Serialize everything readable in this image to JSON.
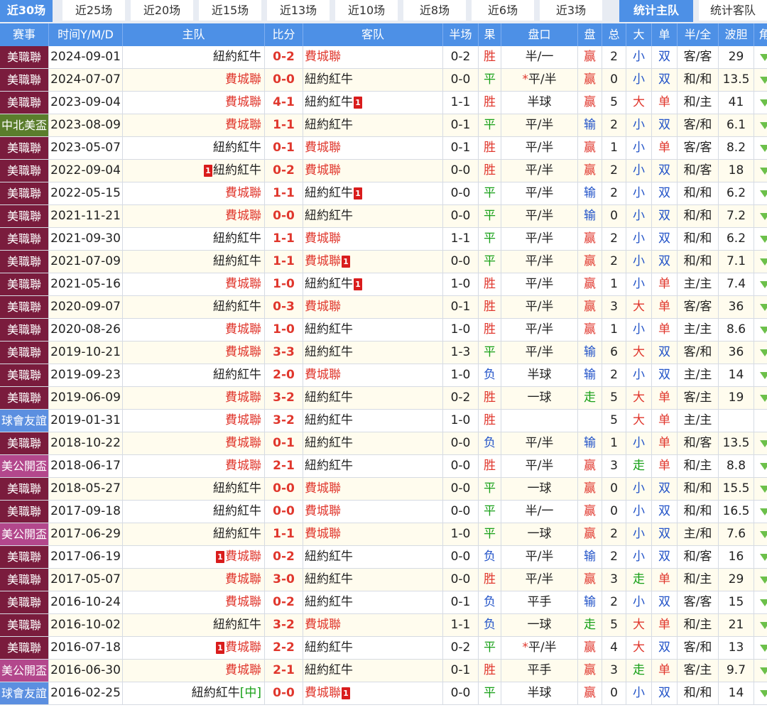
{
  "tabs": [
    "近30场",
    "近25场",
    "近20场",
    "近15场",
    "近13场",
    "近10场",
    "近8场",
    "近6场",
    "近3场",
    "统计主队",
    "统计客队"
  ],
  "headers": [
    "赛事",
    "时间Y/M/D",
    "主队",
    "比分",
    "客队",
    "半场",
    "果",
    "盘口",
    "盘",
    "总",
    "大",
    "单",
    "半/全",
    "波胆",
    "角"
  ],
  "colors": {
    "header_bg": "#4d90e6",
    "mls": "#7a1c3d",
    "concacaf": "#5a7d2c",
    "friendly": "#5b8fe0",
    "us_open": "#b3478c"
  },
  "rows": [
    {
      "league": "美職聯",
      "lt": "mls",
      "date": "2024-09-01",
      "home": "紐約紅牛",
      "home_t": "ny",
      "score": "0-2",
      "away": "費城聯",
      "away_t": "philly",
      "ht": "0-2",
      "res": "胜",
      "rc": "r-win",
      "ah": "半/一",
      "ahr": "赢",
      "ahc": "ah-win",
      "tot": "2",
      "ou": "小",
      "ouc": "small",
      "oe": "双",
      "oec": "even-t",
      "htft": "客/客",
      "odds": "29"
    },
    {
      "league": "美職聯",
      "lt": "mls",
      "date": "2024-07-07",
      "home": "費城聯",
      "home_t": "philly",
      "score": "0-0",
      "away": "紐約紅牛",
      "away_t": "ny",
      "ht": "0-0",
      "res": "平",
      "rc": "r-draw",
      "ah_star": "*",
      "ah": "平/半",
      "ahr": "赢",
      "ahc": "ah-win",
      "tot": "0",
      "ou": "小",
      "ouc": "small",
      "oe": "双",
      "oec": "even-t",
      "htft": "和/和",
      "odds": "13.5"
    },
    {
      "league": "美職聯",
      "lt": "mls",
      "date": "2023-09-04",
      "home": "費城聯",
      "home_t": "philly",
      "score": "4-1",
      "away": "紐約紅牛",
      "away_t": "ny",
      "away_card": "1",
      "ht": "1-1",
      "res": "胜",
      "rc": "r-win",
      "ah": "半球",
      "ahr": "赢",
      "ahc": "ah-win",
      "tot": "5",
      "ou": "大",
      "ouc": "big",
      "oe": "单",
      "oec": "odd-t",
      "htft": "和/主",
      "odds": "41"
    },
    {
      "league": "中北美盃",
      "lt": "concacaf",
      "date": "2023-08-09",
      "home": "費城聯",
      "home_t": "philly",
      "score": "1-1",
      "away": "紐約紅牛",
      "away_t": "ny",
      "ht": "0-1",
      "res": "平",
      "rc": "r-draw",
      "ah": "平/半",
      "ahr": "输",
      "ahc": "ah-lose",
      "tot": "2",
      "ou": "小",
      "ouc": "small",
      "oe": "双",
      "oec": "even-t",
      "htft": "客/和",
      "odds": "6.1"
    },
    {
      "league": "美職聯",
      "lt": "mls",
      "date": "2023-05-07",
      "home": "紐約紅牛",
      "home_t": "ny",
      "score": "0-1",
      "away": "費城聯",
      "away_t": "philly",
      "ht": "0-1",
      "res": "胜",
      "rc": "r-win",
      "ah": "平/半",
      "ahr": "赢",
      "ahc": "ah-win",
      "tot": "1",
      "ou": "小",
      "ouc": "small",
      "oe": "单",
      "oec": "odd-t",
      "htft": "客/客",
      "odds": "8.2"
    },
    {
      "league": "美職聯",
      "lt": "mls",
      "date": "2022-09-04",
      "home_card": "1",
      "home": "紐約紅牛",
      "home_t": "ny",
      "score": "0-2",
      "away": "費城聯",
      "away_t": "philly",
      "ht": "0-0",
      "res": "胜",
      "rc": "r-win",
      "ah": "平/半",
      "ahr": "赢",
      "ahc": "ah-win",
      "tot": "2",
      "ou": "小",
      "ouc": "small",
      "oe": "双",
      "oec": "even-t",
      "htft": "和/客",
      "odds": "18"
    },
    {
      "league": "美職聯",
      "lt": "mls",
      "date": "2022-05-15",
      "home": "費城聯",
      "home_t": "philly",
      "score": "1-1",
      "away": "紐約紅牛",
      "away_t": "ny",
      "away_card": "1",
      "ht": "0-0",
      "res": "平",
      "rc": "r-draw",
      "ah": "平/半",
      "ahr": "输",
      "ahc": "ah-lose",
      "tot": "2",
      "ou": "小",
      "ouc": "small",
      "oe": "双",
      "oec": "even-t",
      "htft": "和/和",
      "odds": "6.2"
    },
    {
      "league": "美職聯",
      "lt": "mls",
      "date": "2021-11-21",
      "home": "費城聯",
      "home_t": "philly",
      "score": "0-0",
      "away": "紐約紅牛",
      "away_t": "ny",
      "ht": "0-0",
      "res": "平",
      "rc": "r-draw",
      "ah": "平/半",
      "ahr": "输",
      "ahc": "ah-lose",
      "tot": "0",
      "ou": "小",
      "ouc": "small",
      "oe": "双",
      "oec": "even-t",
      "htft": "和/和",
      "odds": "7.2"
    },
    {
      "league": "美職聯",
      "lt": "mls",
      "date": "2021-09-30",
      "home": "紐約紅牛",
      "home_t": "ny",
      "score": "1-1",
      "away": "費城聯",
      "away_t": "philly",
      "ht": "1-1",
      "res": "平",
      "rc": "r-draw",
      "ah": "平/半",
      "ahr": "赢",
      "ahc": "ah-win",
      "tot": "2",
      "ou": "小",
      "ouc": "small",
      "oe": "双",
      "oec": "even-t",
      "htft": "和/和",
      "odds": "6.2"
    },
    {
      "league": "美職聯",
      "lt": "mls",
      "date": "2021-07-09",
      "home": "紐約紅牛",
      "home_t": "ny",
      "score": "1-1",
      "away": "費城聯",
      "away_t": "philly",
      "away_card": "1",
      "ht": "0-0",
      "res": "平",
      "rc": "r-draw",
      "ah": "平/半",
      "ahr": "赢",
      "ahc": "ah-win",
      "tot": "2",
      "ou": "小",
      "ouc": "small",
      "oe": "双",
      "oec": "even-t",
      "htft": "和/和",
      "odds": "7.1"
    },
    {
      "league": "美職聯",
      "lt": "mls",
      "date": "2021-05-16",
      "home": "費城聯",
      "home_t": "philly",
      "score": "1-0",
      "away": "紐約紅牛",
      "away_t": "ny",
      "away_card": "1",
      "ht": "1-0",
      "res": "胜",
      "rc": "r-win",
      "ah": "平/半",
      "ahr": "赢",
      "ahc": "ah-win",
      "tot": "1",
      "ou": "小",
      "ouc": "small",
      "oe": "单",
      "oec": "odd-t",
      "htft": "主/主",
      "odds": "7.4"
    },
    {
      "league": "美職聯",
      "lt": "mls",
      "date": "2020-09-07",
      "home": "紐約紅牛",
      "home_t": "ny",
      "score": "0-3",
      "away": "費城聯",
      "away_t": "philly",
      "ht": "0-1",
      "res": "胜",
      "rc": "r-win",
      "ah": "平/半",
      "ahr": "赢",
      "ahc": "ah-win",
      "tot": "3",
      "ou": "大",
      "ouc": "big",
      "oe": "单",
      "oec": "odd-t",
      "htft": "客/客",
      "odds": "36"
    },
    {
      "league": "美職聯",
      "lt": "mls",
      "date": "2020-08-26",
      "home": "費城聯",
      "home_t": "philly",
      "score": "1-0",
      "away": "紐約紅牛",
      "away_t": "ny",
      "ht": "1-0",
      "res": "胜",
      "rc": "r-win",
      "ah": "平/半",
      "ahr": "赢",
      "ahc": "ah-win",
      "tot": "1",
      "ou": "小",
      "ouc": "small",
      "oe": "单",
      "oec": "odd-t",
      "htft": "主/主",
      "odds": "8.6"
    },
    {
      "league": "美職聯",
      "lt": "mls",
      "date": "2019-10-21",
      "home": "費城聯",
      "home_t": "philly",
      "score": "3-3",
      "away": "紐約紅牛",
      "away_t": "ny",
      "ht": "1-3",
      "res": "平",
      "rc": "r-draw",
      "ah": "平/半",
      "ahr": "输",
      "ahc": "ah-lose",
      "tot": "6",
      "ou": "大",
      "ouc": "big",
      "oe": "双",
      "oec": "even-t",
      "htft": "客/和",
      "odds": "36"
    },
    {
      "league": "美職聯",
      "lt": "mls",
      "date": "2019-09-23",
      "home": "紐約紅牛",
      "home_t": "ny",
      "score": "2-0",
      "away": "費城聯",
      "away_t": "philly",
      "ht": "1-0",
      "res": "负",
      "rc": "r-lose",
      "ah": "半球",
      "ahr": "输",
      "ahc": "ah-lose",
      "tot": "2",
      "ou": "小",
      "ouc": "small",
      "oe": "双",
      "oec": "even-t",
      "htft": "主/主",
      "odds": "14"
    },
    {
      "league": "美職聯",
      "lt": "mls",
      "date": "2019-06-09",
      "home": "費城聯",
      "home_t": "philly",
      "score": "3-2",
      "away": "紐約紅牛",
      "away_t": "ny",
      "ht": "0-2",
      "res": "胜",
      "rc": "r-win",
      "ah": "一球",
      "ahr": "走",
      "ahc": "ah-push",
      "tot": "5",
      "ou": "大",
      "ouc": "big",
      "oe": "单",
      "oec": "odd-t",
      "htft": "客/主",
      "odds": "19"
    },
    {
      "league": "球會友誼",
      "lt": "friendly",
      "date": "2019-01-31",
      "home": "費城聯",
      "home_t": "philly",
      "score": "3-2",
      "away": "紐約紅牛",
      "away_t": "ny",
      "ht": "1-0",
      "res": "胜",
      "rc": "r-win",
      "ah": "",
      "ahr": "",
      "ahc": "ah-win",
      "tot": "5",
      "ou": "大",
      "ouc": "big",
      "oe": "单",
      "oec": "odd-t",
      "htft": "主/主",
      "odds": ""
    },
    {
      "league": "美職聯",
      "lt": "mls",
      "date": "2018-10-22",
      "home": "費城聯",
      "home_t": "philly",
      "score": "0-1",
      "away": "紐約紅牛",
      "away_t": "ny",
      "ht": "0-0",
      "res": "负",
      "rc": "r-lose",
      "ah": "平/半",
      "ahr": "输",
      "ahc": "ah-lose",
      "tot": "1",
      "ou": "小",
      "ouc": "small",
      "oe": "单",
      "oec": "odd-t",
      "htft": "和/客",
      "odds": "13.5"
    },
    {
      "league": "美公開盃",
      "lt": "us_open",
      "date": "2018-06-17",
      "home": "費城聯",
      "home_t": "philly",
      "score": "2-1",
      "away": "紐約紅牛",
      "away_t": "ny",
      "ht": "0-0",
      "res": "胜",
      "rc": "r-win",
      "ah": "平/半",
      "ahr": "赢",
      "ahc": "ah-win",
      "tot": "3",
      "ou": "走",
      "ouc": "push",
      "oe": "单",
      "oec": "odd-t",
      "htft": "和/主",
      "odds": "8.8"
    },
    {
      "league": "美職聯",
      "lt": "mls",
      "date": "2018-05-27",
      "home": "紐約紅牛",
      "home_t": "ny",
      "score": "0-0",
      "away": "費城聯",
      "away_t": "philly",
      "ht": "0-0",
      "res": "平",
      "rc": "r-draw",
      "ah": "一球",
      "ahr": "赢",
      "ahc": "ah-win",
      "tot": "0",
      "ou": "小",
      "ouc": "small",
      "oe": "双",
      "oec": "even-t",
      "htft": "和/和",
      "odds": "15.5"
    },
    {
      "league": "美職聯",
      "lt": "mls",
      "date": "2017-09-18",
      "home": "紐約紅牛",
      "home_t": "ny",
      "score": "0-0",
      "away": "費城聯",
      "away_t": "philly",
      "ht": "0-0",
      "res": "平",
      "rc": "r-draw",
      "ah": "半/一",
      "ahr": "赢",
      "ahc": "ah-win",
      "tot": "0",
      "ou": "小",
      "ouc": "small",
      "oe": "双",
      "oec": "even-t",
      "htft": "和/和",
      "odds": "16.5"
    },
    {
      "league": "美公開盃",
      "lt": "us_open",
      "date": "2017-06-29",
      "home": "紐約紅牛",
      "home_t": "ny",
      "score": "1-1",
      "away": "費城聯",
      "away_t": "philly",
      "ht": "1-0",
      "res": "平",
      "rc": "r-draw",
      "ah": "一球",
      "ahr": "赢",
      "ahc": "ah-win",
      "tot": "2",
      "ou": "小",
      "ouc": "small",
      "oe": "双",
      "oec": "even-t",
      "htft": "主/和",
      "odds": "7.6"
    },
    {
      "league": "美職聯",
      "lt": "mls",
      "date": "2017-06-19",
      "home_card": "1",
      "home": "費城聯",
      "home_t": "philly",
      "score": "0-2",
      "away": "紐約紅牛",
      "away_t": "ny",
      "ht": "0-0",
      "res": "负",
      "rc": "r-lose",
      "ah": "平/半",
      "ahr": "输",
      "ahc": "ah-lose",
      "tot": "2",
      "ou": "小",
      "ouc": "small",
      "oe": "双",
      "oec": "even-t",
      "htft": "和/客",
      "odds": "16"
    },
    {
      "league": "美職聯",
      "lt": "mls",
      "date": "2017-05-07",
      "home": "費城聯",
      "home_t": "philly",
      "score": "3-0",
      "away": "紐約紅牛",
      "away_t": "ny",
      "ht": "0-0",
      "res": "胜",
      "rc": "r-win",
      "ah": "平/半",
      "ahr": "赢",
      "ahc": "ah-win",
      "tot": "3",
      "ou": "走",
      "ouc": "push",
      "oe": "单",
      "oec": "odd-t",
      "htft": "和/主",
      "odds": "29"
    },
    {
      "league": "美職聯",
      "lt": "mls",
      "date": "2016-10-24",
      "home": "費城聯",
      "home_t": "philly",
      "score": "0-2",
      "away": "紐約紅牛",
      "away_t": "ny",
      "ht": "0-1",
      "res": "负",
      "rc": "r-lose",
      "ah": "平手",
      "ahr": "输",
      "ahc": "ah-lose",
      "tot": "2",
      "ou": "小",
      "ouc": "small",
      "oe": "双",
      "oec": "even-t",
      "htft": "客/客",
      "odds": "15"
    },
    {
      "league": "美職聯",
      "lt": "mls",
      "date": "2016-10-02",
      "home": "紐約紅牛",
      "home_t": "ny",
      "score": "3-2",
      "away": "費城聯",
      "away_t": "philly",
      "ht": "1-1",
      "res": "负",
      "rc": "r-lose",
      "ah": "一球",
      "ahr": "走",
      "ahc": "ah-push",
      "tot": "5",
      "ou": "大",
      "ouc": "big",
      "oe": "单",
      "oec": "odd-t",
      "htft": "和/主",
      "odds": "21"
    },
    {
      "league": "美職聯",
      "lt": "mls",
      "date": "2016-07-18",
      "home_card": "1",
      "home": "費城聯",
      "home_t": "philly",
      "score": "2-2",
      "away": "紐約紅牛",
      "away_t": "ny",
      "ht": "0-2",
      "res": "平",
      "rc": "r-draw",
      "ah_star": "*",
      "ah": "平/半",
      "ahr": "赢",
      "ahc": "ah-win",
      "tot": "4",
      "ou": "大",
      "ouc": "big",
      "oe": "双",
      "oec": "even-t",
      "htft": "客/和",
      "odds": "13"
    },
    {
      "league": "美公開盃",
      "lt": "us_open",
      "date": "2016-06-30",
      "home": "費城聯",
      "home_t": "philly",
      "score": "2-1",
      "away": "紐約紅牛",
      "away_t": "ny",
      "ht": "0-1",
      "res": "胜",
      "rc": "r-win",
      "ah": "平手",
      "ahr": "赢",
      "ahc": "ah-win",
      "tot": "3",
      "ou": "走",
      "ouc": "push",
      "oe": "单",
      "oec": "odd-t",
      "htft": "客/主",
      "odds": "9.7"
    },
    {
      "league": "球會友誼",
      "lt": "friendly",
      "date": "2016-02-25",
      "home": "紐約紅牛",
      "home_t": "ny",
      "home_neutral": "[中]",
      "score": "0-0",
      "away": "費城聯",
      "away_t": "philly",
      "away_card": "1",
      "ht": "0-0",
      "res": "平",
      "rc": "r-draw",
      "ah": "半球",
      "ahr": "赢",
      "ahc": "ah-win",
      "tot": "0",
      "ou": "小",
      "ouc": "small",
      "oe": "双",
      "oec": "even-t",
      "htft": "和/和",
      "odds": "14"
    }
  ]
}
